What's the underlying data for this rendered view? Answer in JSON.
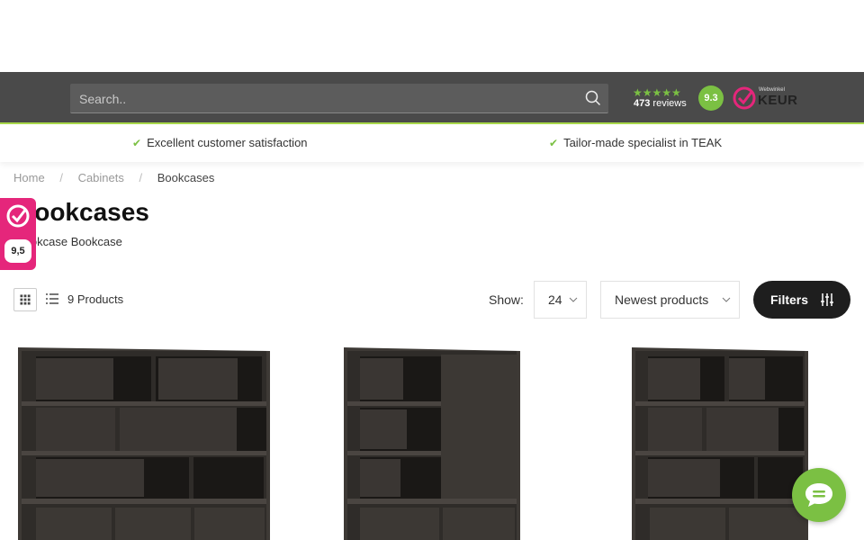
{
  "header": {
    "search_placeholder": "Search..",
    "rating_stars": "★★★★★",
    "reviews_count": "473",
    "reviews_label": "reviews",
    "score": "9.3",
    "keur_small": "Webwinkel",
    "keur_label": "KEUR"
  },
  "usps": [
    "Excellent customer satisfaction",
    "Tailor-made specialist in TEAK"
  ],
  "breadcrumb": [
    "Home",
    "Cabinets",
    "Bookcases"
  ],
  "page": {
    "title": "Bookcases",
    "subtitle": "Bookcase Bookcase"
  },
  "side_badge": {
    "score": "9,5"
  },
  "toolbar": {
    "product_count": "9 Products",
    "show_label": "Show:",
    "show_value": "24",
    "sort_value": "Newest products",
    "filters_label": "Filters"
  },
  "products": [
    {
      "name": "bookcase-product-1"
    },
    {
      "name": "bookcase-product-2"
    },
    {
      "name": "bookcase-product-3"
    }
  ],
  "icons": {
    "search": "search-icon",
    "grid": "grid-view-icon",
    "list": "list-view-icon",
    "filters": "sliders-icon",
    "chat": "chat-icon",
    "check": "check-icon"
  },
  "colors": {
    "header_bg": "#4a4a4a",
    "accent_green": "#7bc043",
    "keur_pink": "#e5267b",
    "filters_bg": "#1e1e1e"
  }
}
